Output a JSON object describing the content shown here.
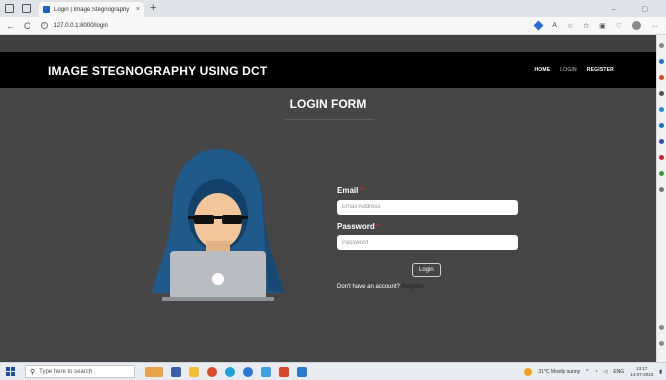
{
  "browser": {
    "tab_title": "Login | Image Stegnography",
    "tab_close": "×",
    "new_tab": "+",
    "window_controls": "–  ▢",
    "back": "←",
    "reload": "C",
    "url": "127.0.0.1:8000/login"
  },
  "site": {
    "brand": "IMAGE STEGNOGRAPHY USING DCT",
    "nav": {
      "home": "HOME",
      "login": "LOGIN",
      "register": "REGISTER"
    }
  },
  "form": {
    "title": "LOGIN FORM",
    "email_label": "Email",
    "email_placeholder": "Email Address",
    "password_label": "Password",
    "password_placeholder": "Password",
    "required_mark": "*",
    "submit": "Login",
    "no_account": "Don't have an account?",
    "register_link": "Register"
  },
  "taskbar": {
    "search_placeholder": "Type here to search",
    "weather": "31°C Mostly sunny",
    "lang": "ENG",
    "time": "13:17",
    "date": "14-07-2023"
  },
  "colors": {
    "header_bg": "#000000",
    "page_bg": "#464646",
    "hood": "#1f5a8a",
    "laptop": "#b9bcc0"
  }
}
